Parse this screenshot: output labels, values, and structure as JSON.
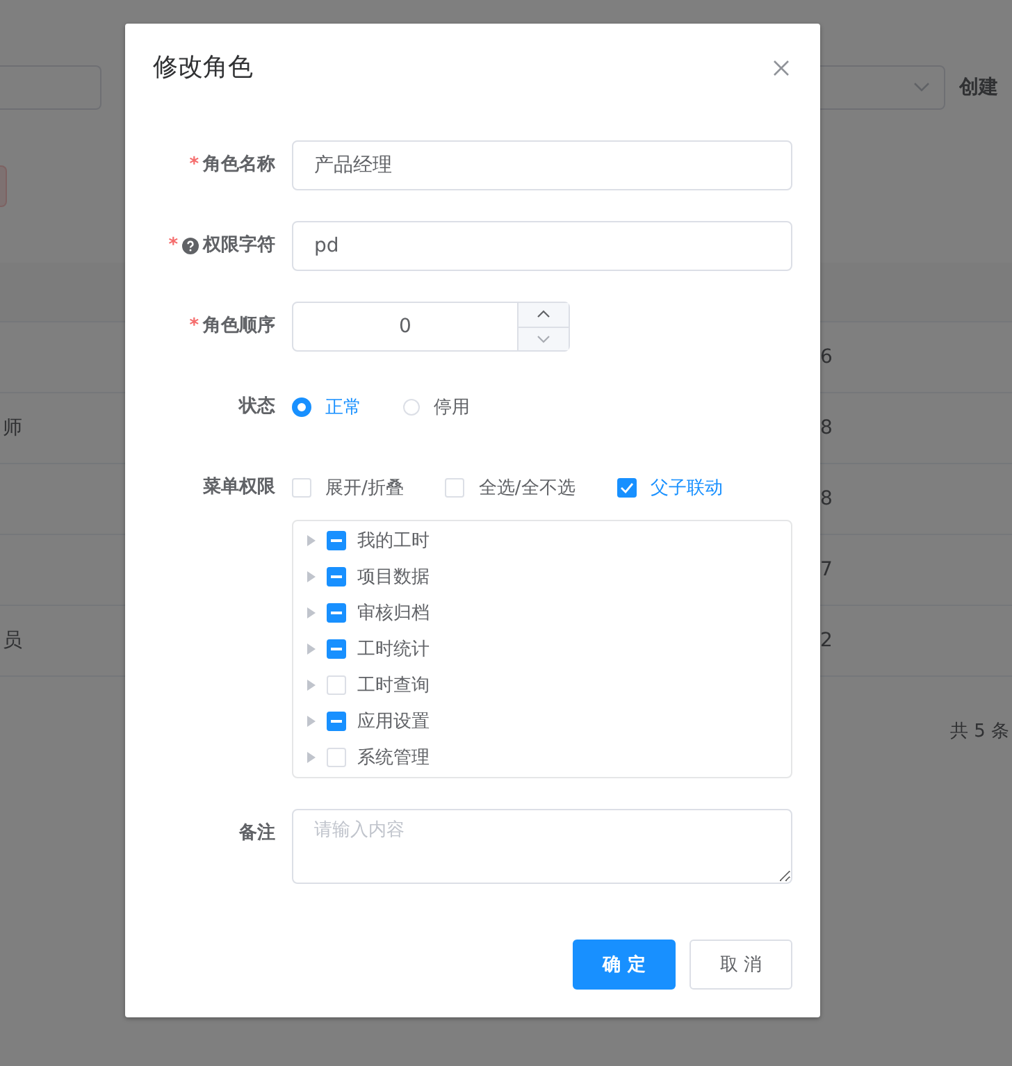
{
  "background": {
    "filter_label": "创建",
    "rows": [
      {
        "value": "6"
      },
      {
        "label": "师",
        "value": "8"
      },
      {
        "value": "8"
      },
      {
        "value": "7"
      },
      {
        "label": "员",
        "value": "2"
      }
    ],
    "pagination": "共 5 条"
  },
  "dialog": {
    "title": "修改角色",
    "fields": [
      {
        "kind": "text",
        "label": "角色名称",
        "required_mark": "*",
        "value": "产品经理"
      },
      {
        "kind": "text",
        "label": "权限字符",
        "required_mark": "*",
        "help": true,
        "value": "pd"
      },
      {
        "kind": "number",
        "label": "角色顺序",
        "required_mark": "*",
        "value": "0"
      },
      {
        "kind": "radio",
        "label": "状态",
        "options": [
          {
            "label": "正常",
            "selected": true
          },
          {
            "label": "停用",
            "selected": false
          }
        ]
      },
      {
        "kind": "tree",
        "label": "菜单权限",
        "options": [
          {
            "label": "展开/折叠",
            "checked": false
          },
          {
            "label": "全选/全不选",
            "checked": false
          },
          {
            "label": "父子联动",
            "checked": true
          }
        ],
        "nodes": [
          {
            "label": "我的工时",
            "indeterminate": true
          },
          {
            "label": "项目数据",
            "indeterminate": true
          },
          {
            "label": "审核归档",
            "indeterminate": true
          },
          {
            "label": "工时统计",
            "indeterminate": true
          },
          {
            "label": "工时查询",
            "indeterminate": false
          },
          {
            "label": "应用设置",
            "indeterminate": true
          },
          {
            "label": "系统管理",
            "indeterminate": false
          }
        ]
      },
      {
        "kind": "textarea",
        "label": "备注",
        "placeholder": "请输入内容"
      }
    ],
    "buttons": [
      {
        "label": "确 定",
        "primary": true
      },
      {
        "label": "取 消",
        "primary": false
      }
    ]
  }
}
